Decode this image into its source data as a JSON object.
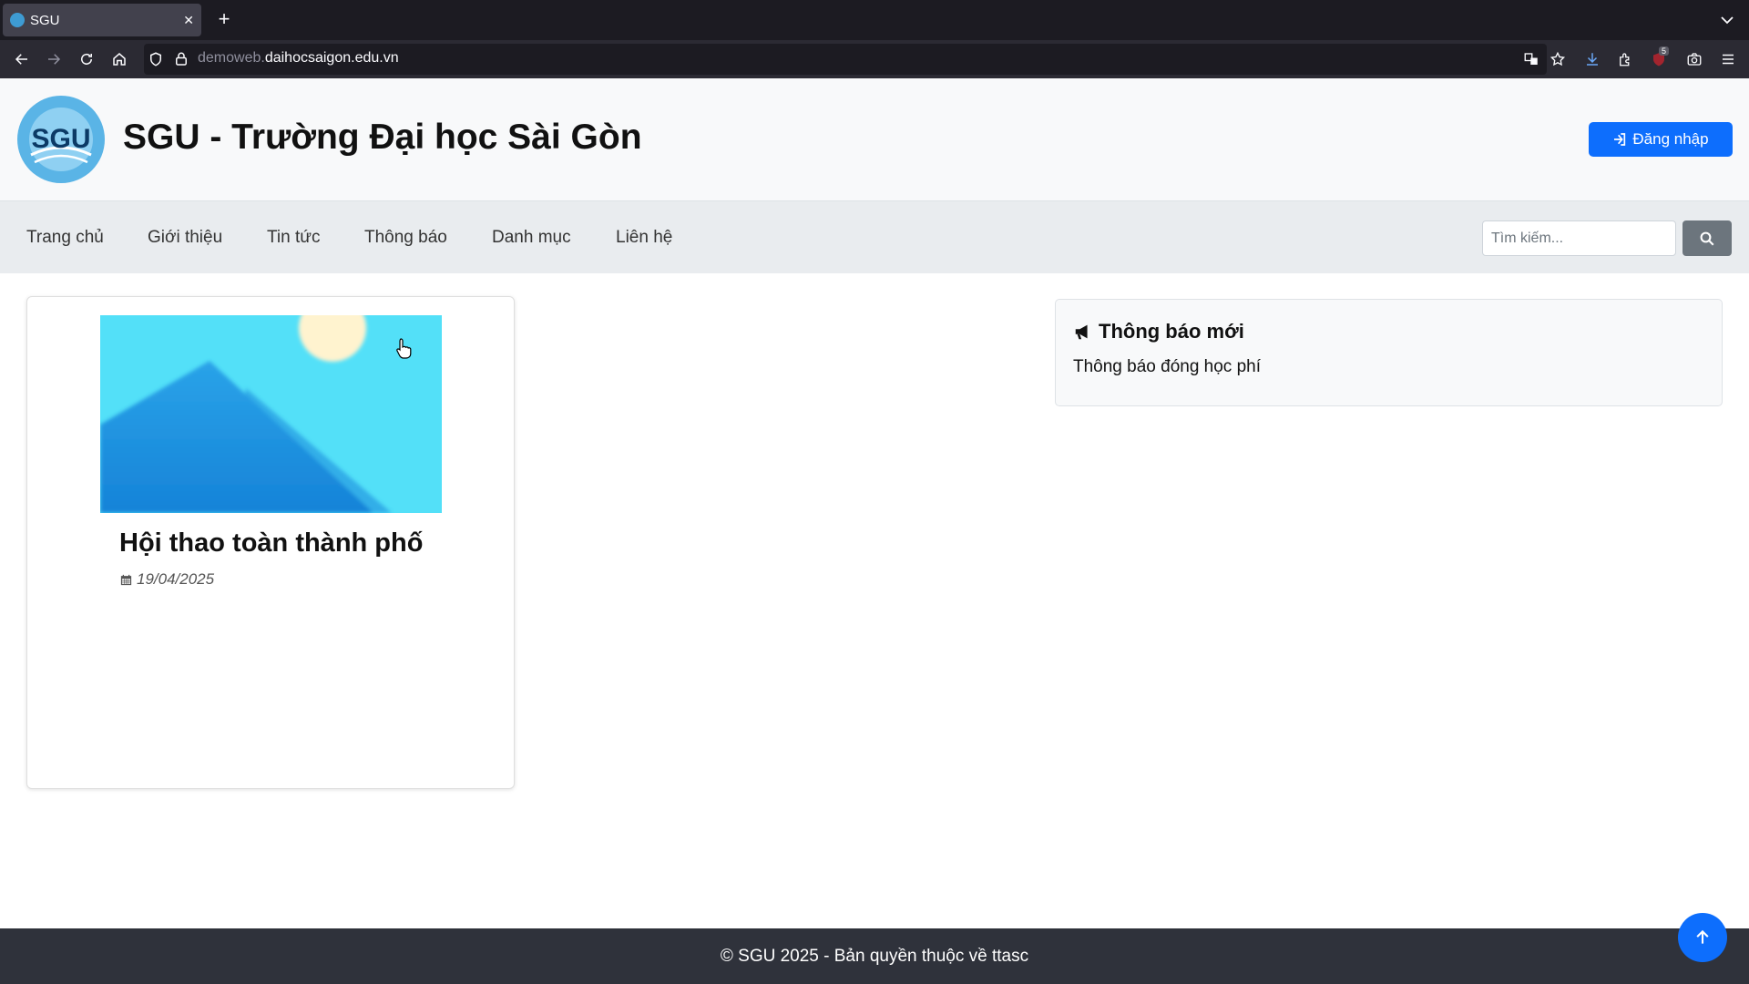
{
  "browser": {
    "tab_title": "SGU",
    "favicon_text": "SGU",
    "url_dim": "demoweb.",
    "url_main": "daihocsaigon.edu.vn",
    "extension_badge": "5"
  },
  "header": {
    "site_title": "SGU - Trường Đại học Sài Gòn",
    "logo_text": "SGU",
    "login_label": "Đăng nhập"
  },
  "nav": {
    "items": [
      {
        "label": "Trang chủ"
      },
      {
        "label": "Giới thiệu"
      },
      {
        "label": "Tin tức"
      },
      {
        "label": "Thông báo"
      },
      {
        "label": "Danh mục"
      },
      {
        "label": "Liên hệ"
      }
    ],
    "search_placeholder": "Tìm kiếm..."
  },
  "news": {
    "title": "Hội thao toàn thành phố",
    "date": "19/04/2025"
  },
  "notices": {
    "heading": "Thông báo mới",
    "items": [
      "Thông báo đóng học phí"
    ]
  },
  "footer": {
    "copyright": "© SGU 2025 - Bản quyền thuộc về ttasc"
  },
  "colors": {
    "primary": "#0d6efd",
    "secondary": "#6c757d",
    "footer_bg": "#2f323b"
  }
}
